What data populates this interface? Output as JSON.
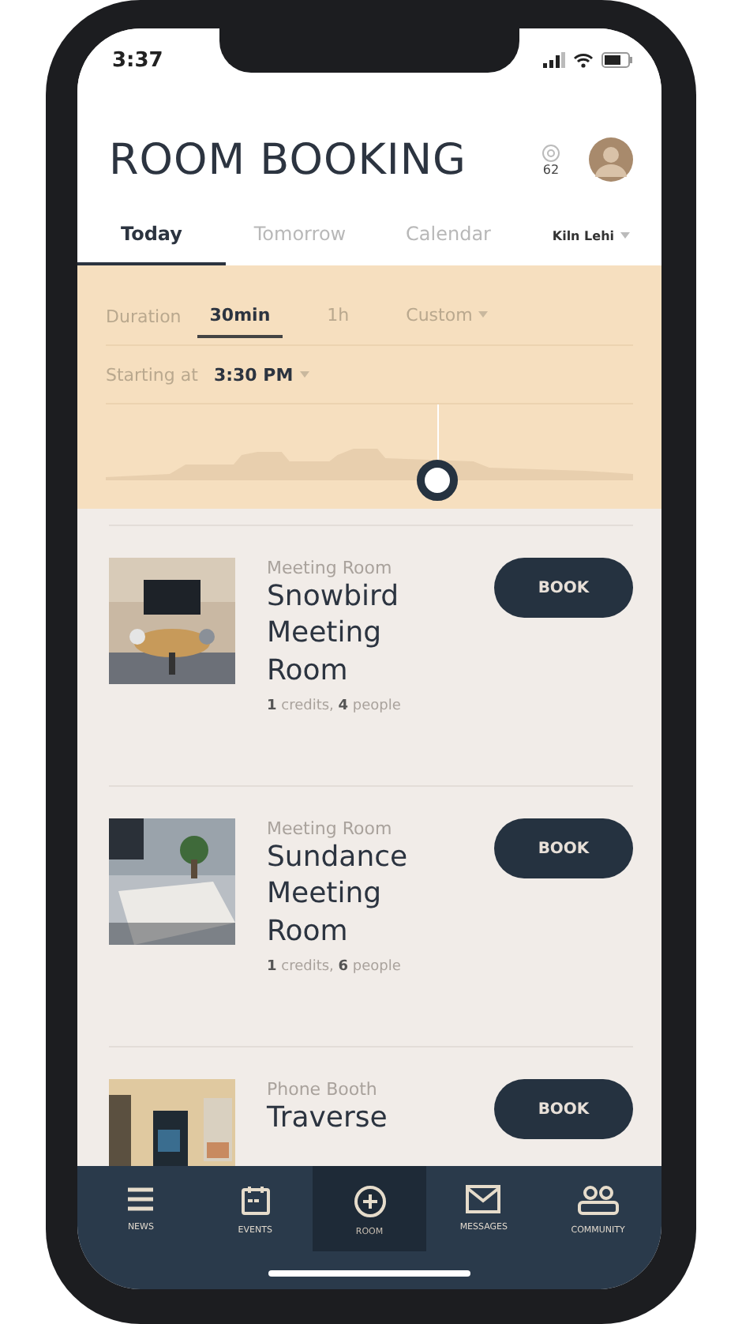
{
  "status_bar": {
    "time": "3:37"
  },
  "header": {
    "title": "ROOM BOOKING",
    "credits": "62"
  },
  "tabs": [
    {
      "label": "Today",
      "selected": true
    },
    {
      "label": "Tomorrow",
      "selected": false
    },
    {
      "label": "Calendar",
      "selected": false
    }
  ],
  "location": {
    "label": "Kiln Lehi"
  },
  "filters": {
    "duration_label": "Duration",
    "durations": [
      {
        "label": "30min",
        "selected": true
      },
      {
        "label": "1h",
        "selected": false
      },
      {
        "label": "Custom",
        "selected": false,
        "dropdown": true
      }
    ],
    "start_label": "Starting at",
    "start_time": "3:30 PM",
    "timeline": {
      "level": 0.63
    }
  },
  "rooms": [
    {
      "type": "Meeting Room",
      "name": "Snowbird Meeting Room",
      "details": "**1** credits, **4** people",
      "button": "BOOK"
    },
    {
      "type": "Meeting Room",
      "name": "Sundance Meeting Room",
      "details": "**1** credits, **6** people",
      "button": "BOOK"
    },
    {
      "type": "Phone Booth",
      "name": "Traverse",
      "button": "BOOK"
    }
  ],
  "nav": [
    {
      "kind": "news",
      "label": "NEWS",
      "selected": false
    },
    {
      "kind": "events",
      "label": "EVENTS",
      "selected": false
    },
    {
      "kind": "room",
      "label": "ROOM",
      "selected": true
    },
    {
      "kind": "messages",
      "label": "MESSAGES",
      "selected": false
    },
    {
      "kind": "community",
      "label": "COMMUNITY",
      "selected": false
    }
  ]
}
